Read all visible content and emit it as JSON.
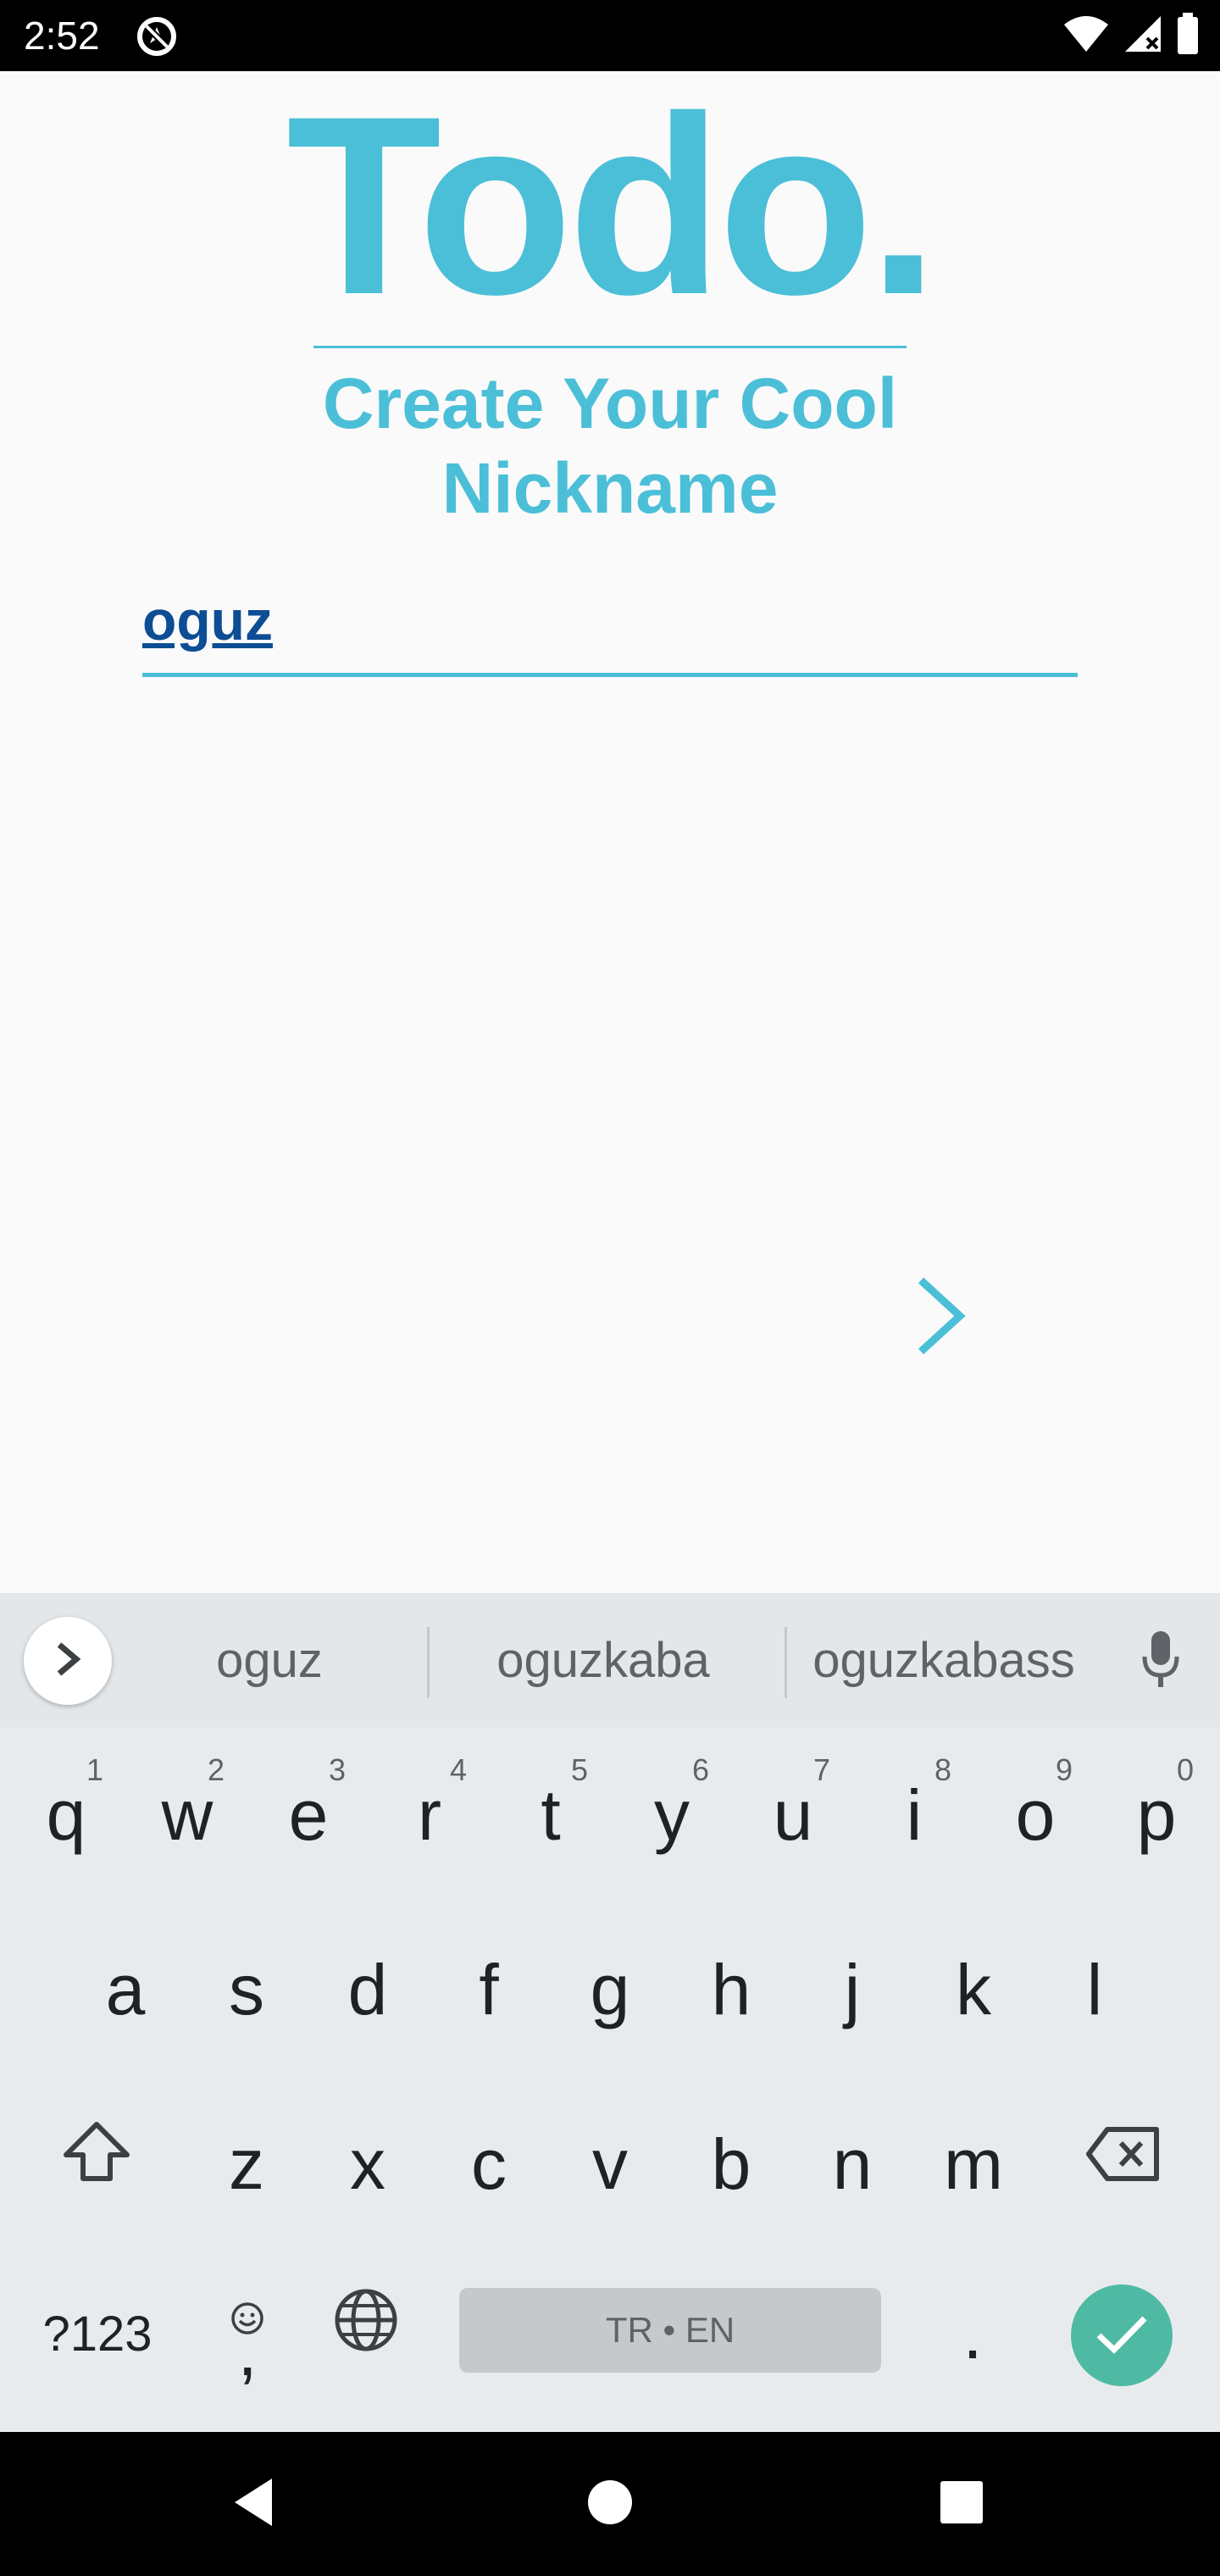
{
  "status_bar": {
    "time": "2:52",
    "app_icon": "no-location-circle-icon",
    "icons": [
      "wifi-icon",
      "cell-signal-icon",
      "battery-icon"
    ]
  },
  "app": {
    "title": "Todo.",
    "subtitle": "Create Your Cool Nickname",
    "accent_color": "#4bbfd7"
  },
  "nickname_input": {
    "value": "oguz"
  },
  "next_button": {
    "icon": "chevron-right-icon"
  },
  "keyboard": {
    "suggestions": [
      "oguz",
      "oguzkaba",
      "oguzkabass"
    ],
    "row1": [
      {
        "key": "q",
        "hint": "1"
      },
      {
        "key": "w",
        "hint": "2"
      },
      {
        "key": "e",
        "hint": "3"
      },
      {
        "key": "r",
        "hint": "4"
      },
      {
        "key": "t",
        "hint": "5"
      },
      {
        "key": "y",
        "hint": "6"
      },
      {
        "key": "u",
        "hint": "7"
      },
      {
        "key": "i",
        "hint": "8"
      },
      {
        "key": "o",
        "hint": "9"
      },
      {
        "key": "p",
        "hint": "0"
      }
    ],
    "row2": [
      "a",
      "s",
      "d",
      "f",
      "g",
      "h",
      "j",
      "k",
      "l"
    ],
    "row3": [
      "z",
      "x",
      "c",
      "v",
      "b",
      "n",
      "m"
    ],
    "symbols_label": "?123",
    "emoji_comma_label": ",",
    "space_label": "TR • EN",
    "period_label": ".",
    "done_color": "#4fbaa3"
  }
}
